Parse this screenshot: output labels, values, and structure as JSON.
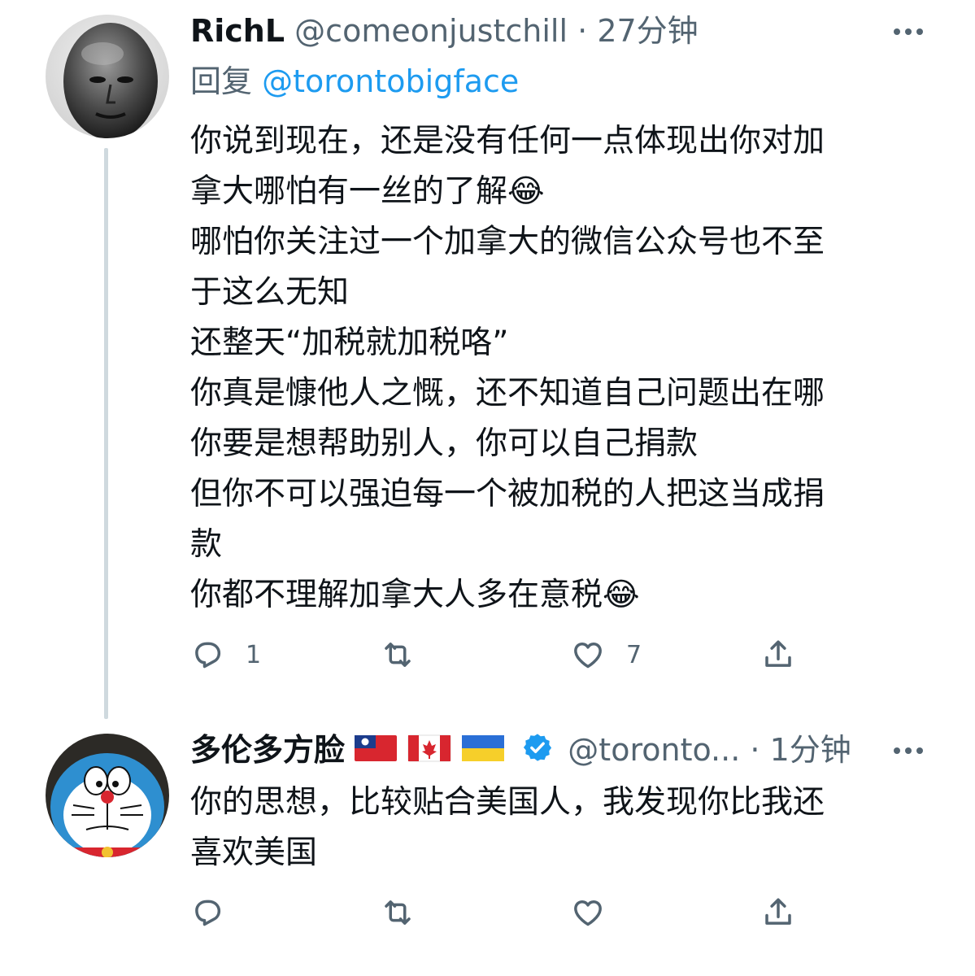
{
  "tweets": [
    {
      "author_name": "RichL",
      "handle": "@comeonjustchill",
      "separator": "·",
      "time": "27分钟",
      "reply_prefix": "回复",
      "reply_to": "@torontobigface",
      "lines": [
        "你说到现在，还是没有任何一点体现出你对加",
        "拿大哪怕有一丝的了解😂",
        "哪怕你关注过一个加拿大的微信公众号也不至",
        "于这么无知",
        "还整天“加税就加税咯”",
        "你真是慷他人之慨，还不知道自己问题出在哪",
        "你要是想帮助别人，你可以自己捐款",
        "但你不可以强迫每一个被加税的人把这当成捐",
        "款",
        "你都不理解加拿大人多在意税😂"
      ],
      "reply_count": "1",
      "retweet_count": "",
      "like_count": "7",
      "avatar_icon": "bald-man-portrait",
      "actions_icons": [
        "reply-icon",
        "retweet-icon",
        "like-icon",
        "share-icon"
      ]
    },
    {
      "author_name": "多伦多方脸",
      "flags": [
        "taiwan-flag",
        "canada-flag",
        "ukraine-flag"
      ],
      "verified": true,
      "handle": "@toronto...",
      "separator": "·",
      "time": "1分钟",
      "lines": [
        "你的思想，比较贴合美国人，我发现你比我还",
        "喜欢美国"
      ],
      "reply_count": "",
      "retweet_count": "",
      "like_count": "",
      "avatar_icon": "doraemon-avatar"
    }
  ],
  "colors": {
    "text": "#0f1419",
    "secondary": "#536471",
    "link": "#1d9bf0",
    "thread_line": "#cfd9de"
  }
}
